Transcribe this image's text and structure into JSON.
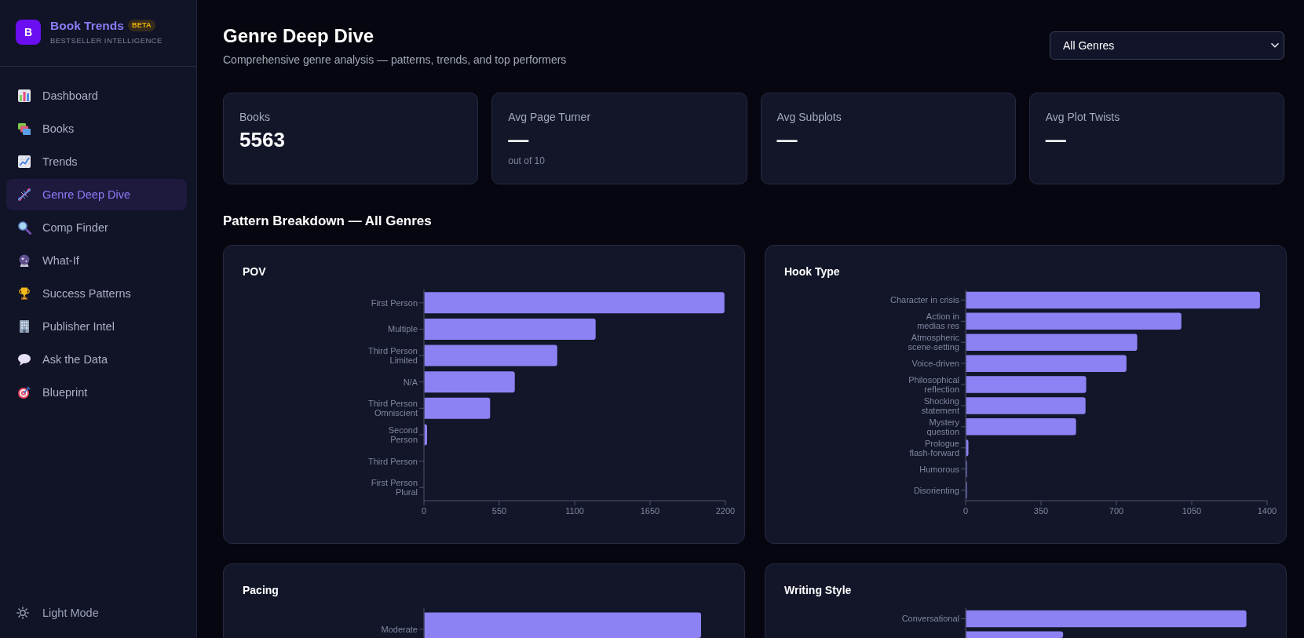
{
  "sidebar": {
    "brand": {
      "logo": "B",
      "name": "Book Trends",
      "badge": "BETA",
      "tagline": "BESTSELLER INTELLIGENCE"
    },
    "nav": [
      {
        "label": "Dashboard",
        "selected": false
      },
      {
        "label": "Books",
        "selected": false
      },
      {
        "label": "Trends",
        "selected": false
      },
      {
        "label": "Genre Deep Dive",
        "selected": true
      },
      {
        "label": "Comp Finder",
        "selected": false
      },
      {
        "label": "What-If",
        "selected": false
      },
      {
        "label": "Success Patterns",
        "selected": false
      },
      {
        "label": "Publisher Intel",
        "selected": false
      },
      {
        "label": "Ask the Data",
        "selected": false
      },
      {
        "label": "Blueprint",
        "selected": false
      }
    ],
    "theme_toggle": {
      "label": "Light Mode"
    }
  },
  "header": {
    "title": "Genre Deep Dive",
    "subtitle": "Comprehensive genre analysis — patterns, trends, and top performers",
    "genre_select": {
      "value": "All Genres"
    }
  },
  "stats": [
    {
      "label": "Books",
      "value": "5563"
    },
    {
      "label": "Avg Page Turner",
      "value": "—",
      "note": "out of 10"
    },
    {
      "label": "Avg Subplots",
      "value": "—"
    },
    {
      "label": "Avg Plot Twists",
      "value": "—"
    }
  ],
  "section_title": "Pattern Breakdown — All Genres",
  "pattern_cards": [
    {
      "kind": "chart",
      "title": "POV",
      "chart_data": {
        "type": "bar",
        "orientation": "horizontal",
        "categories": [
          "First Person",
          "Multiple",
          "Third Person\nLimited",
          "N/A",
          "Third Person\nOmniscient",
          "Second\nPerson",
          "Third Person",
          "First Person\nPlural"
        ],
        "values": [
          2190,
          1250,
          970,
          660,
          480,
          20,
          0,
          0
        ],
        "xlim": [
          0,
          2200
        ],
        "xticks": [
          0,
          550,
          1100,
          1650,
          2200
        ]
      }
    },
    {
      "kind": "chart",
      "title": "Hook Type",
      "chart_data": {
        "type": "bar",
        "orientation": "horizontal",
        "categories": [
          "Character in crisis",
          "Action in\nmedias res",
          "Atmospheric\nscene-setting",
          "Voice-driven",
          "Philosophical\nreflection",
          "Shocking\nstatement",
          "Mystery\nquestion",
          "Prologue\nflash-forward",
          "Humorous",
          "Disorienting"
        ],
        "values": [
          1365,
          1000,
          795,
          745,
          558,
          555,
          511,
          11,
          4,
          4
        ],
        "xlim": [
          0,
          1400
        ],
        "xticks": [
          0,
          350,
          700,
          1050,
          1400
        ]
      }
    },
    {
      "kind": "partial",
      "title": "Pacing",
      "labels": [
        "Moderate"
      ]
    },
    {
      "kind": "partial",
      "title": "Writing Style",
      "labels": [
        "Conversational"
      ]
    }
  ]
}
